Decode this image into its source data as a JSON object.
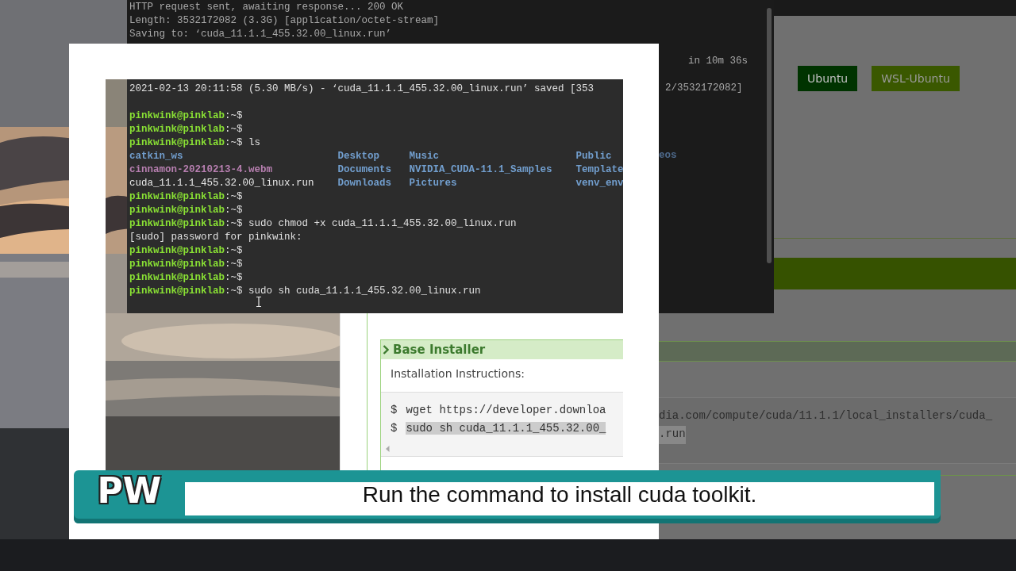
{
  "background_terminal": {
    "lines": [
      "HTTP request sent, awaiting response... 200 OK",
      "Length: 3532172082 (3.3G) [application/octet-stream]",
      "Saving to: ‘cuda_11.1.1_455.32.00_linux.run’"
    ],
    "progress_tail": "in 10m 36s",
    "saved_tail": "2/3532172082]",
    "listing_tail": "eos"
  },
  "web_page": {
    "buttons": [
      {
        "label": "Ubuntu",
        "selected": true
      },
      {
        "label": "WSL-Ubuntu",
        "selected": false
      }
    ],
    "code_tail": [
      {
        "text": "dia.com/compute/cuda/11.1.1/local_installers/cuda_",
        "highlighted": false
      },
      {
        "text": ".run",
        "highlighted": true
      }
    ]
  },
  "spotlight": {
    "terminal": [
      {
        "kind": "output",
        "text": "2021-02-13 20:11:58 (5.30 MB/s) - ‘cuda_11.1.1_455.32.00_linux.run’ saved [353"
      },
      {
        "kind": "blank"
      },
      {
        "kind": "prompt",
        "user": "pinkwink@pinklab",
        "suffix": ":~$"
      },
      {
        "kind": "prompt",
        "user": "pinkwink@pinklab",
        "suffix": ":~$"
      },
      {
        "kind": "prompt",
        "user": "pinkwink@pinklab",
        "suffix": ":~$",
        "command": "ls"
      },
      {
        "kind": "listing",
        "cells": [
          {
            "text": "catkin_ws",
            "kind": "dir"
          },
          {
            "text": "Desktop",
            "kind": "dir"
          },
          {
            "text": "Music",
            "kind": "dir"
          },
          {
            "text": "Public",
            "kind": "dir"
          }
        ]
      },
      {
        "kind": "listing",
        "cells": [
          {
            "text": "cinnamon-20210213-4.webm",
            "kind": "video"
          },
          {
            "text": "Documents",
            "kind": "dir"
          },
          {
            "text": "NVIDIA_CUDA-11.1_Samples",
            "kind": "dir"
          },
          {
            "text": "Template",
            "kind": "dir"
          }
        ]
      },
      {
        "kind": "listing",
        "cells": [
          {
            "text": "cuda_11.1.1_455.32.00_linux.run",
            "kind": "file"
          },
          {
            "text": "Downloads",
            "kind": "dir"
          },
          {
            "text": "Pictures",
            "kind": "dir"
          },
          {
            "text": "venv_env",
            "kind": "dir"
          }
        ]
      },
      {
        "kind": "prompt",
        "user": "pinkwink@pinklab",
        "suffix": ":~$"
      },
      {
        "kind": "prompt",
        "user": "pinkwink@pinklab",
        "suffix": ":~$"
      },
      {
        "kind": "prompt",
        "user": "pinkwink@pinklab",
        "suffix": ":~$",
        "command": "sudo chmod +x cuda_11.1.1_455.32.00_linux.run"
      },
      {
        "kind": "output",
        "text": "[sudo] password for pinkwink:"
      },
      {
        "kind": "prompt",
        "user": "pinkwink@pinklab",
        "suffix": ":~$"
      },
      {
        "kind": "prompt",
        "user": "pinkwink@pinklab",
        "suffix": ":~$"
      },
      {
        "kind": "prompt",
        "user": "pinkwink@pinklab",
        "suffix": ":~$"
      },
      {
        "kind": "prompt",
        "user": "pinkwink@pinklab",
        "suffix": ":~$",
        "command": "sudo sh cuda_11.1.1_455.32.00_linux.run"
      }
    ],
    "section_title": "Base Installer",
    "instructions_label": "Installation Instructions:",
    "code": [
      {
        "prompt": "$",
        "command": "wget https://developer.downloa",
        "highlighted": false
      },
      {
        "prompt": "$",
        "command": "sudo sh cuda_11.1.1_455.32.00_",
        "highlighted": true
      }
    ]
  },
  "caption": {
    "logo": "PW",
    "text": "Run the command to install cuda toolkit."
  }
}
